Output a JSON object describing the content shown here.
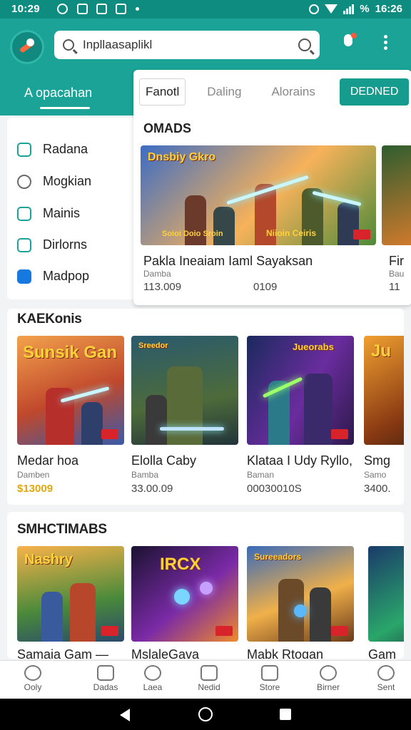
{
  "status_bar": {
    "time_left": "10:29",
    "time_right": "16:26",
    "battery_text": "%"
  },
  "search": {
    "value": "Inpllaasaplikl",
    "placeholder": ""
  },
  "app_tab": {
    "label": "A opacahan"
  },
  "sidebar": {
    "items": [
      {
        "label": "Radana",
        "icon": "gamepad-icon"
      },
      {
        "label": "Mogkian",
        "icon": "settings-icon"
      },
      {
        "label": "Mainis",
        "icon": "image-icon"
      },
      {
        "label": "Dirlorns",
        "icon": "tablet-icon"
      },
      {
        "label": "Madpop",
        "icon": "account-icon"
      }
    ]
  },
  "chips": {
    "c1": "Fanotl",
    "c2": "Daling",
    "c3": "Alorains",
    "c4": "DEDNED"
  },
  "panel": {
    "title": "OMADS",
    "banner_title": "Dnsbiy Gkro",
    "banner_sub": "Soioi Doio Sroin",
    "banner_sub2": "Niioin Ceiris",
    "app_name": "Pakla Ineaiam Iaml Sayaksan",
    "app_sub": "Damba",
    "price1": "113.009",
    "price2": "0109",
    "second_name": "Fir",
    "second_sub": "Bau",
    "second_price": "11"
  },
  "section1": {
    "title": "KAEKonis",
    "cards": [
      {
        "name": "Medar hoa",
        "sub": "Damben",
        "price": "$13009",
        "art": "Sunsik Gan"
      },
      {
        "name": "Elolla Caby",
        "sub": "Bamba",
        "price": "33.00.09",
        "art": "Sreedor"
      },
      {
        "name": "Klataa I Udy Ryllo,",
        "sub": "Baman",
        "price": "00030010S",
        "art": "Jueorabs"
      },
      {
        "name": "Smg",
        "sub": "Samo",
        "price": "3400.",
        "art": "Ju"
      }
    ]
  },
  "section2": {
    "title": "SMHCTIMABS",
    "cards": [
      {
        "name": "Samaia Gam —",
        "art": "Nashry"
      },
      {
        "name": "MslaleGava",
        "art": "IRCX"
      },
      {
        "name": "Mabk Rtogan",
        "art": "Sureeadors"
      },
      {
        "name": "Gam",
        "art": ""
      }
    ]
  },
  "bottom_nav": [
    {
      "label": "Ooly",
      "icon": "people-icon"
    },
    {
      "label": "Dadas",
      "icon": "list-icon"
    },
    {
      "label": "Laea",
      "icon": "flower-icon"
    },
    {
      "label": "Nedid",
      "icon": "media-icon"
    },
    {
      "label": "Store",
      "icon": "store-icon"
    },
    {
      "label": "Birner",
      "icon": "search-icon"
    },
    {
      "label": "Sent",
      "icon": "copyright-icon"
    }
  ]
}
